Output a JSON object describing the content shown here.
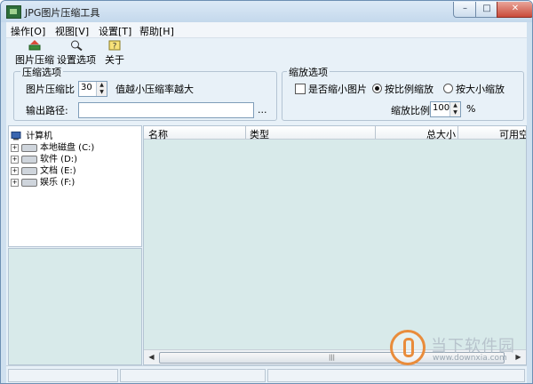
{
  "window": {
    "title": "JPG图片压缩工具",
    "controls": {
      "minimize": "–",
      "maximize": "□",
      "close": "✕"
    }
  },
  "menu": [
    "操作[O]",
    "视图[V]",
    "设置[T]",
    "帮助[H]"
  ],
  "toolbar": {
    "compress_label": "图片压缩",
    "settings_label": "设置选项",
    "about_label": "关于"
  },
  "compress_options": {
    "title": "压缩选项",
    "ratio_label": "图片压缩比",
    "ratio_value": "30",
    "hint": "值越小压缩率越大",
    "output_label": "输出路径:",
    "output_value": "",
    "browse_label": "..."
  },
  "scale_options": {
    "title": "缩放选项",
    "shrink_label": "是否缩小图片",
    "shrink_checked": false,
    "by_ratio_label": "按比例缩放",
    "by_size_label": "按大小缩放",
    "selected_mode": "by_ratio",
    "ratio_label": "缩放比例",
    "ratio_value": "100",
    "ratio_unit": "%"
  },
  "tree": {
    "root": "计算机",
    "drives": [
      {
        "label": "本地磁盘 (C:)"
      },
      {
        "label": "软件 (D:)"
      },
      {
        "label": "文档 (E:)"
      },
      {
        "label": "娱乐 (F:)"
      }
    ]
  },
  "file_list": {
    "columns": [
      "名称",
      "类型",
      "总大小",
      "可用空"
    ],
    "rows": [],
    "scroll_thumb": "|||"
  },
  "watermark": {
    "text": "当下软件园",
    "url": "www.downxia.com"
  },
  "colors": {
    "client_bg": "#e8f1f8",
    "list_bg": "#d8eaea",
    "close_button": "#c94a3a"
  }
}
